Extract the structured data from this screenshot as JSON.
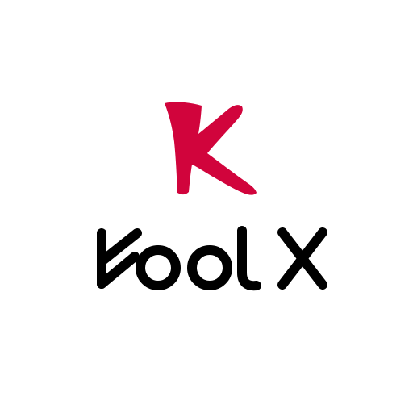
{
  "logo": {
    "wordmark": "KoolX",
    "mark_color": "#d1043c",
    "wordmark_color": "#000000",
    "icon": "k-mark-icon"
  },
  "background_color": "#ffffff"
}
